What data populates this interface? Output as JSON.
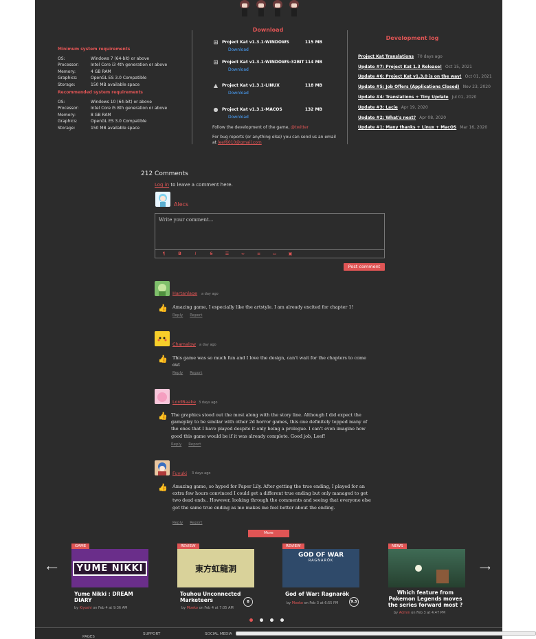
{
  "requirements": {
    "minimum": {
      "title": "Minimum system requirements",
      "rows": [
        {
          "k": "OS:",
          "v": "Windows 7 (64-bit) or above"
        },
        {
          "k": "Processor:",
          "v": "Intel Core i3 4th generation or above"
        },
        {
          "k": "Memory:",
          "v": "4 GB RAM"
        },
        {
          "k": "Graphics:",
          "v": "OpenGL ES 3.0 Compatible"
        },
        {
          "k": "Storage:",
          "v": "150 MB available space"
        }
      ]
    },
    "recommended": {
      "title": "Recommended system requirements",
      "rows": [
        {
          "k": "OS:",
          "v": "Windows 10 (64-bit) or above"
        },
        {
          "k": "Processor:",
          "v": "Intel Core i5 8th generation or above"
        },
        {
          "k": "Memory:",
          "v": "8 GB RAM"
        },
        {
          "k": "Graphics:",
          "v": "OpenGL ES 3.0 Compatible"
        },
        {
          "k": "Storage:",
          "v": "150 MB available space"
        }
      ]
    }
  },
  "download": {
    "title": "Download",
    "files": [
      {
        "name": "Project Kat v1.3.1-WINDOWS",
        "size": "115 MB",
        "icon": "windows-icon",
        "link": "Download"
      },
      {
        "name": "Project Kat v1.3.1-WINDOWS-32BIT",
        "size": "114 MB",
        "icon": "windows-icon",
        "link": "Download"
      },
      {
        "name": "Project Kat v1.3.1-LINUX",
        "size": "118 MB",
        "icon": "linux-icon",
        "link": "Download"
      },
      {
        "name": "Project Kat v1.3.1-MACOS",
        "size": "132 MB",
        "icon": "apple-icon",
        "link": "Download"
      }
    ],
    "follow_text": "Follow the development of the game,",
    "follow_link": "@twitter",
    "bug_text": "For bug reports (or anything else) you can send us an email at",
    "bug_email": "leef6010@gmail.com"
  },
  "devlog": {
    "title": "Development log",
    "items": [
      {
        "t": "Project Kat Translations",
        "d": "70 days ago"
      },
      {
        "t": "Update #7: Project Kat 1.3 Release!",
        "d": "Oct 15, 2021"
      },
      {
        "t": "Update #6: Project Kat v1.3.0 is on the way!",
        "d": "Oct 01, 2021"
      },
      {
        "t": "Update #5: Job Offers (Applications Closed)",
        "d": "Nov 23, 2020"
      },
      {
        "t": "Update #4: Translations + Tiny Update",
        "d": "Jul 01, 2020"
      },
      {
        "t": "Update #3: Lacie",
        "d": "Apr 19, 2020"
      },
      {
        "t": "Update #2: What's next?",
        "d": "Apr 08, 2020"
      },
      {
        "t": "Update #1: Many thanks + Linux + MacOS",
        "d": "Mar 16, 2020"
      }
    ]
  },
  "comments": {
    "count_title": "212 Comments",
    "login_link": "Log in",
    "login_text": "to leave a comment here.",
    "current_user": "Alecs",
    "placeholder": "Write your comment...",
    "post_label": "Post comment",
    "more_label": "More",
    "reply_label": "Reply",
    "report_label": "Report",
    "items": [
      {
        "user": "Hartanlage",
        "ago": "a day ago",
        "text": "Amazing game, I especially like the artstyle. I am already excited for chapter 1!"
      },
      {
        "user": "Chamalow",
        "ago": "a day ago",
        "text": "This game was so much fun and I love the design, can't wait for the chapters to come out"
      },
      {
        "user": "LordBaake",
        "ago": "3 days ago",
        "text": "The graphics stood out the most along with the story line.  Although I did expect the gameplay to be similar with other 2d horror games, this one definitely topped many of the ones that I have played despite it only being a prologue. I can't even imagine how good this game would be if it was already complete. Good job, Leef!"
      },
      {
        "user": "Fuyuki",
        "ago": "3 days ago",
        "text": "Amazing game, so hyped for Paper Lily. After getting the true ending, I played for an extra few hours convinced I could get a different true ending but only managed to get two dead ends.. However, looking through the comments and seeing that everyone else got the same true ending as me makes me feel better about the ending."
      }
    ]
  },
  "carousel": {
    "cards": [
      {
        "tag": "GAME",
        "title": "Yume Nikki : DREAM DIARY",
        "by": "by",
        "author": "Kiyoshi",
        "date": "on Feb 4 at 9:36 AM",
        "score": ""
      },
      {
        "tag": "REVIEW",
        "title": "Touhou Unconnected Marketeers",
        "by": "by",
        "author": "Moeko",
        "date": "on Feb 4 at 7:05 AM",
        "score": "8"
      },
      {
        "tag": "REVIEW",
        "title": "God of War: Ragnarök",
        "by": "by",
        "author": "Moeko",
        "date": "on Feb 3 at 6:55 PM",
        "score": "9.5"
      },
      {
        "tag": "NEWS",
        "title": "Which feature from Pokemon Legends moves the series forward most ?",
        "by": "by",
        "author": "Admin",
        "date": "on Feb 3 at 4:47 PM",
        "score": ""
      }
    ],
    "img_texts": [
      "YUME NIKKI",
      "東方虹龍洞",
      "GOD OF WAR",
      "RAGNARÖK"
    ]
  },
  "footer": {
    "pages": "PAGES",
    "support": "SUPPORT",
    "social": "SOCIAL MEDIA"
  },
  "colors": {
    "accent": "#e05555",
    "link": "#4aa3ff",
    "panel": "#2c2c2c"
  }
}
